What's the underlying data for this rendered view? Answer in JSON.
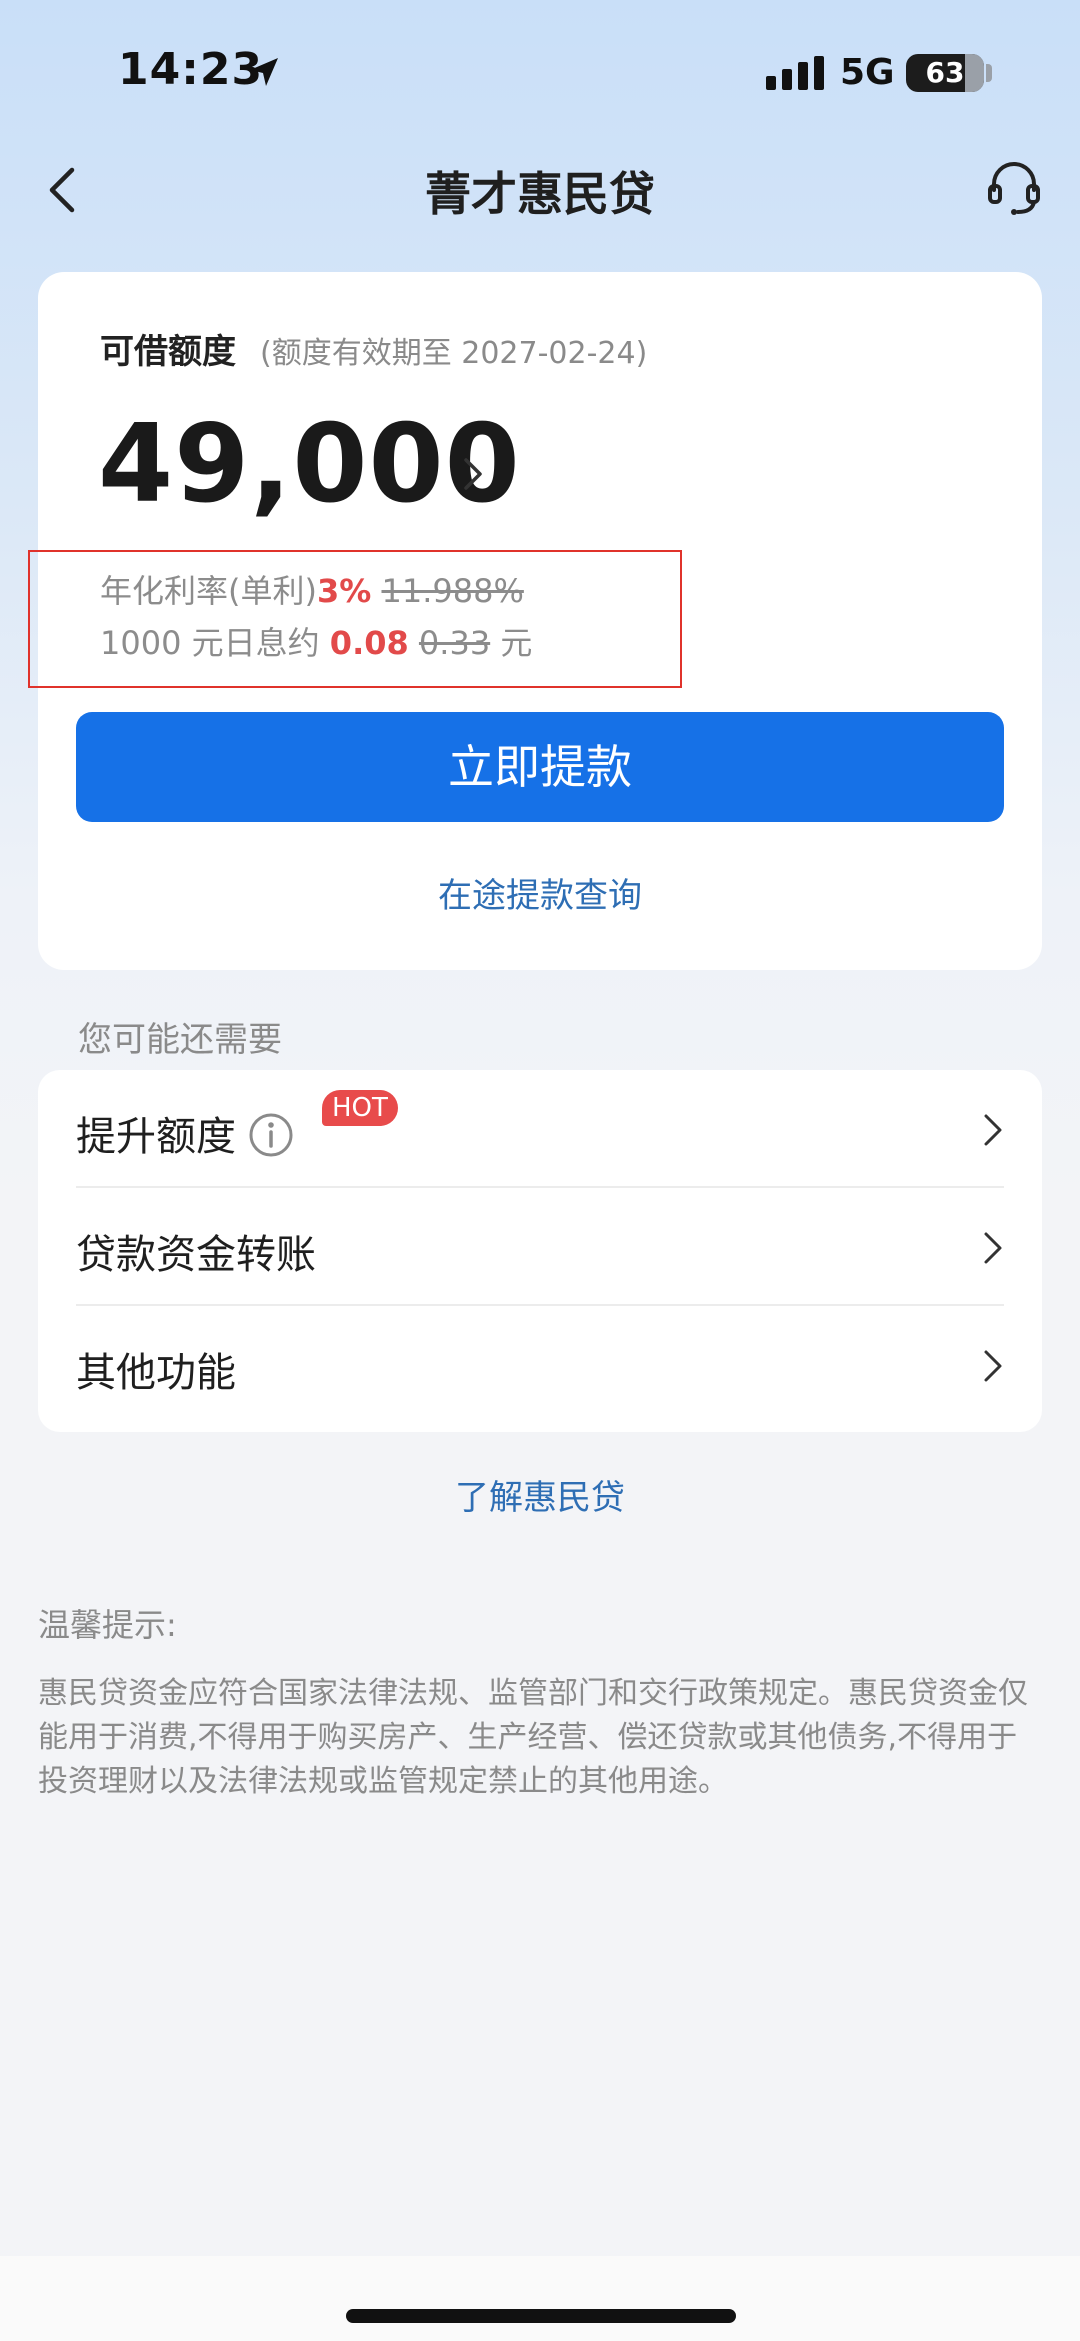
{
  "status_bar": {
    "time": "14:23",
    "network": "5G",
    "battery_level": "63",
    "icons": [
      "location-arrow-icon",
      "signal-icon",
      "battery-icon"
    ]
  },
  "nav": {
    "title": "菁才惠民贷",
    "icons": [
      "chevron-left-icon",
      "customer-service-icon"
    ]
  },
  "credit": {
    "label": "可借额度",
    "validity_note": "(额度有效期至 2027-02-24)",
    "amount": "49,000",
    "rate_prefix": "年化利率(单利)",
    "rate_current": "3%",
    "rate_original": "11.988%",
    "daily_prefix": "1000 元日息约 ",
    "daily_current": "0.08",
    "daily_original": "0.33",
    "daily_unit": " 元"
  },
  "actions": {
    "withdraw_label": "立即提款",
    "query_label": "在途提款查询"
  },
  "more_section": {
    "title": "您可能还需要",
    "items": [
      {
        "label": "提升额度",
        "badge": "HOT"
      },
      {
        "label": "贷款资金转账"
      },
      {
        "label": "其他功能"
      }
    ]
  },
  "learn_link": "了解惠民贷",
  "tips": {
    "title": "温馨提示:",
    "body": "惠民贷资金应符合国家法律法规、监管部门和交行政策规定。惠民贷资金仅能用于消费,不得用于购买房产、生产经营、偿还贷款或其他债务,不得用于投资理财以及法律法规或监管规定禁止的其他用途。"
  },
  "colors": {
    "primary": "#1671e7",
    "link": "#2e6eb4",
    "accent_red": "#e24a4a",
    "annotation_box": "#e0322b"
  }
}
